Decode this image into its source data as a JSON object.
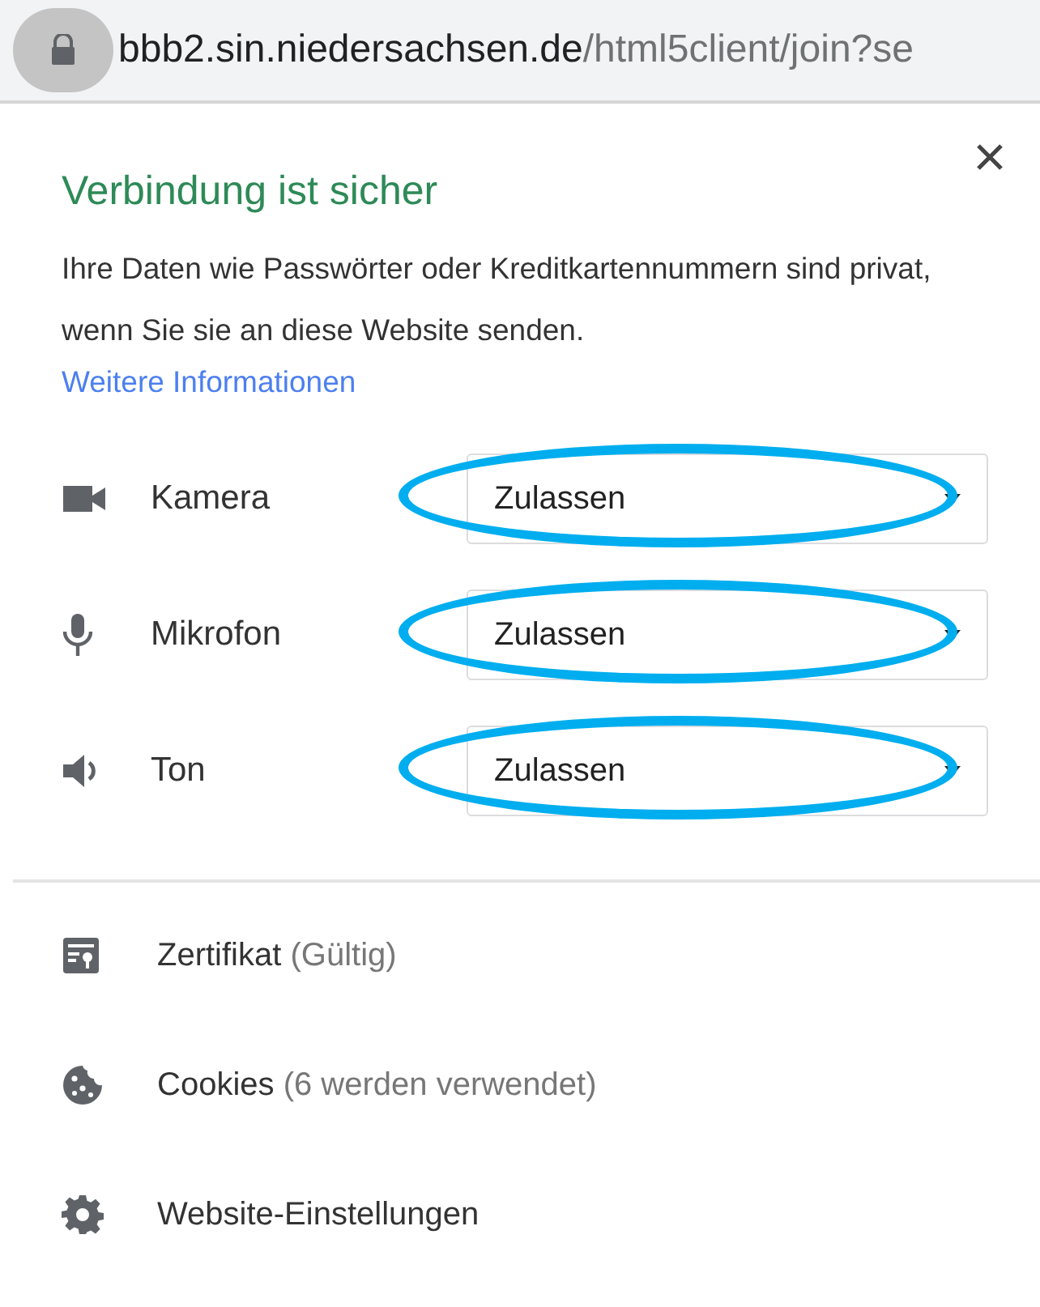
{
  "address_bar": {
    "domain": "bbb2.sin.niedersachsen.de",
    "path": "/html5client/join?se"
  },
  "popup": {
    "title": "Verbindung ist sicher",
    "description": "Ihre Daten wie Passwörter oder Kreditkartennummern sind privat, wenn Sie sie an diese Website senden.",
    "link": "Weitere Informationen"
  },
  "permissions": [
    {
      "kind": "camera",
      "label": "Kamera",
      "value": "Zulassen",
      "highlighted": true
    },
    {
      "kind": "microphone",
      "label": "Mikrofon",
      "value": "Zulassen",
      "highlighted": true
    },
    {
      "kind": "sound",
      "label": "Ton",
      "value": "Zulassen",
      "highlighted": true
    }
  ],
  "links": [
    {
      "kind": "certificate",
      "label": "Zertifikat",
      "detail": "(Gültig)"
    },
    {
      "kind": "cookies",
      "label": "Cookies",
      "detail": "(6 werden verwendet)"
    },
    {
      "kind": "settings",
      "label": "Website-Einstellungen"
    }
  ]
}
